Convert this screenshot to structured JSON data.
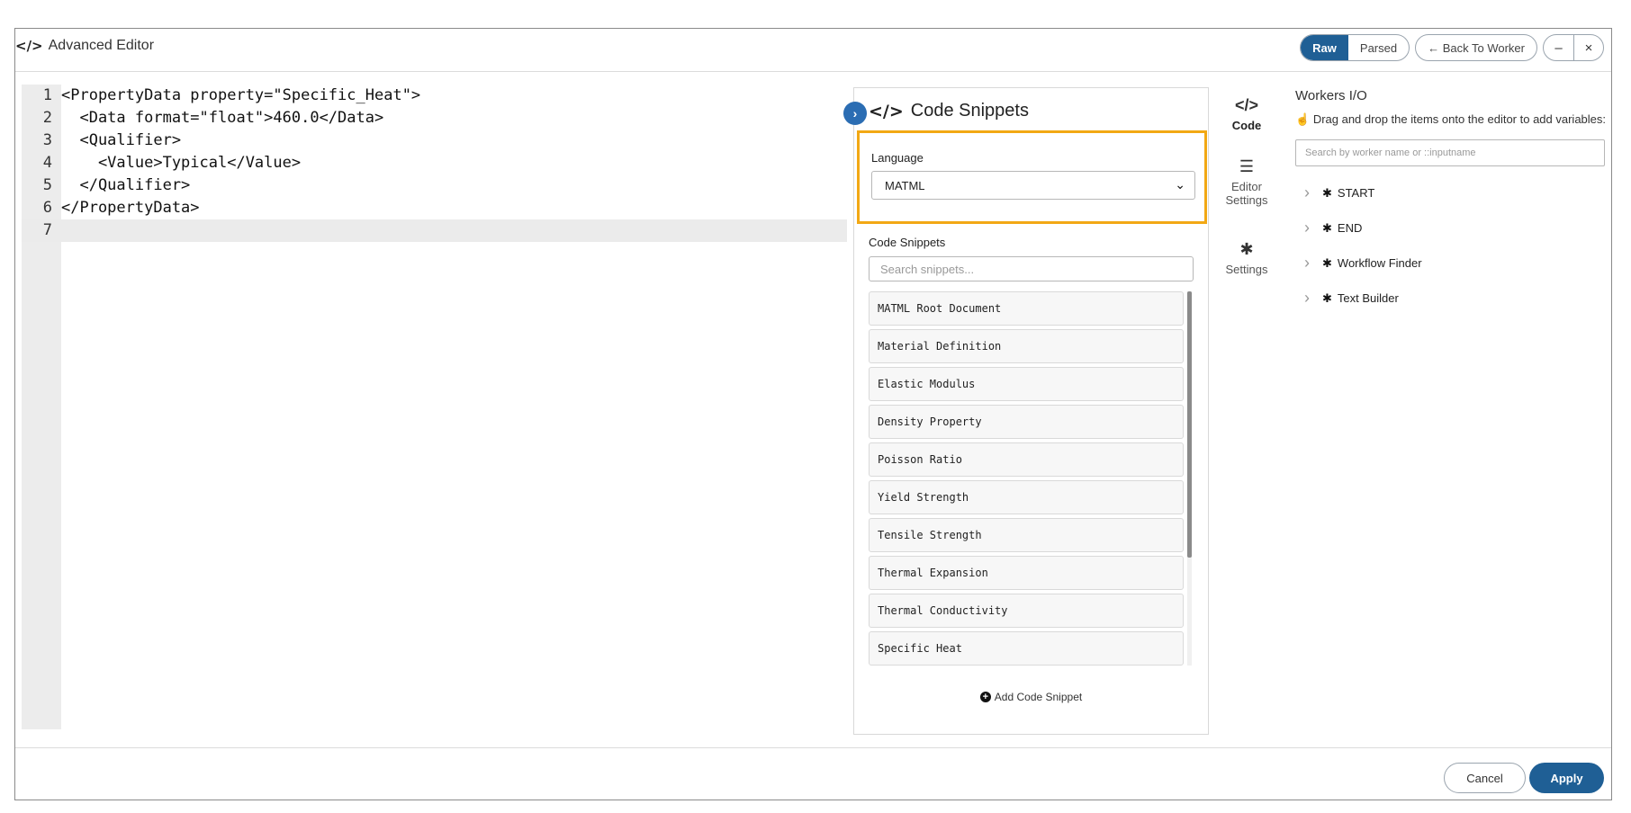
{
  "window": {
    "title": "Advanced Editor",
    "title_icon": "code-icon"
  },
  "toolbar": {
    "raw_label": "Raw",
    "parsed_label": "Parsed",
    "back_label": "← Back To Worker",
    "minimize_symbol": "–",
    "close_symbol": "×"
  },
  "editor": {
    "lines": [
      {
        "number": "1",
        "text": "<PropertyData property=\"Specific_Heat\">"
      },
      {
        "number": "2",
        "text": "  <Data format=\"float\">460.0</Data>"
      },
      {
        "number": "3",
        "text": "  <Qualifier>"
      },
      {
        "number": "4",
        "text": "    <Value>Typical</Value>"
      },
      {
        "number": "5",
        "text": "  </Qualifier>"
      },
      {
        "number": "6",
        "text": "</PropertyData>"
      },
      {
        "number": "7",
        "text": ""
      }
    ]
  },
  "snippets_panel": {
    "title": "Code Snippets",
    "collapse_symbol": "›",
    "language_label": "Language",
    "language_value": "MATML",
    "snippets_label": "Code Snippets",
    "search_placeholder": "Search snippets...",
    "items": [
      "MATML Root Document",
      "Material Definition",
      "Elastic Modulus",
      "Density Property",
      "Poisson Ratio",
      "Yield Strength",
      "Tensile Strength",
      "Thermal Expansion",
      "Thermal Conductivity",
      "Specific Heat"
    ],
    "add_label": "Add Code Snippet",
    "highlight_color": "#f2a814"
  },
  "side_tabs": {
    "code_label": "Code",
    "editor_settings_label_1": "Editor",
    "editor_settings_label_2": "Settings",
    "settings_label": "Settings"
  },
  "workers": {
    "title": "Workers I/O",
    "hint": "Drag and drop the items onto the editor to add variables:",
    "search_placeholder": "Search by worker name or ::inputname",
    "items": [
      "START",
      "END",
      "Workflow Finder",
      "Text Builder"
    ]
  },
  "footer": {
    "cancel_label": "Cancel",
    "apply_label": "Apply"
  },
  "colors": {
    "primary": "#1f5f95",
    "collapse_button": "#2b6db3"
  }
}
